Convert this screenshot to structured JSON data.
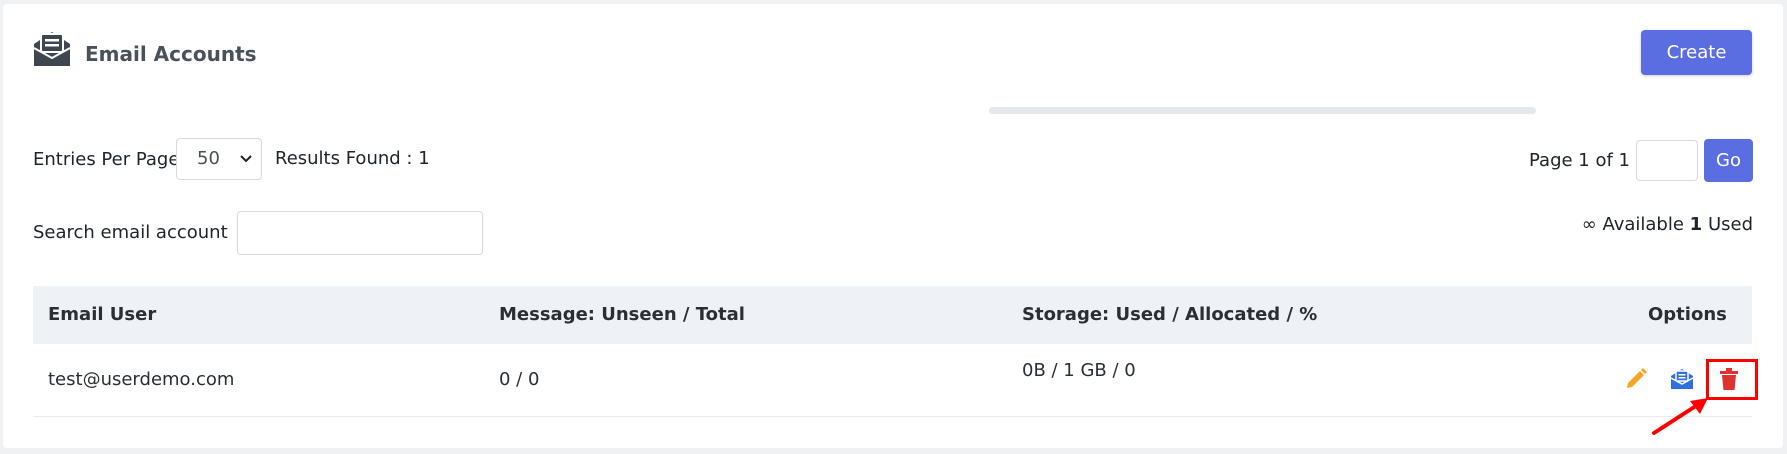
{
  "header": {
    "title": "Email Accounts",
    "icon": "envelope-open-icon",
    "create_label": "Create"
  },
  "controls": {
    "entries_label": "Entries Per Page",
    "entries_value": "50",
    "results_label": "Results Found : 1",
    "page_label": "Page 1 of 1",
    "page_input_value": "",
    "go_label": "Go",
    "search_label": "Search email account",
    "search_value": "",
    "available_symbol": "∞",
    "available_label": "Available",
    "used_count": "1",
    "used_label": "Used"
  },
  "table": {
    "columns": [
      "Email User",
      "Message: Unseen / Total",
      "Storage: Used / Allocated / %",
      "Options"
    ],
    "rows": [
      {
        "email": "test@userdemo.com",
        "messages": "0 / 0",
        "storage": "0B / 1 GB / 0",
        "storage_percent": 0,
        "options": [
          "pencil-icon",
          "envelope-open-icon",
          "trash-icon"
        ]
      }
    ]
  },
  "colors": {
    "accent": "#5b6ee1",
    "edit": "#f5a623",
    "mailbox": "#2f6fe0",
    "delete": "#e03131",
    "annotation": "#ff0000"
  }
}
